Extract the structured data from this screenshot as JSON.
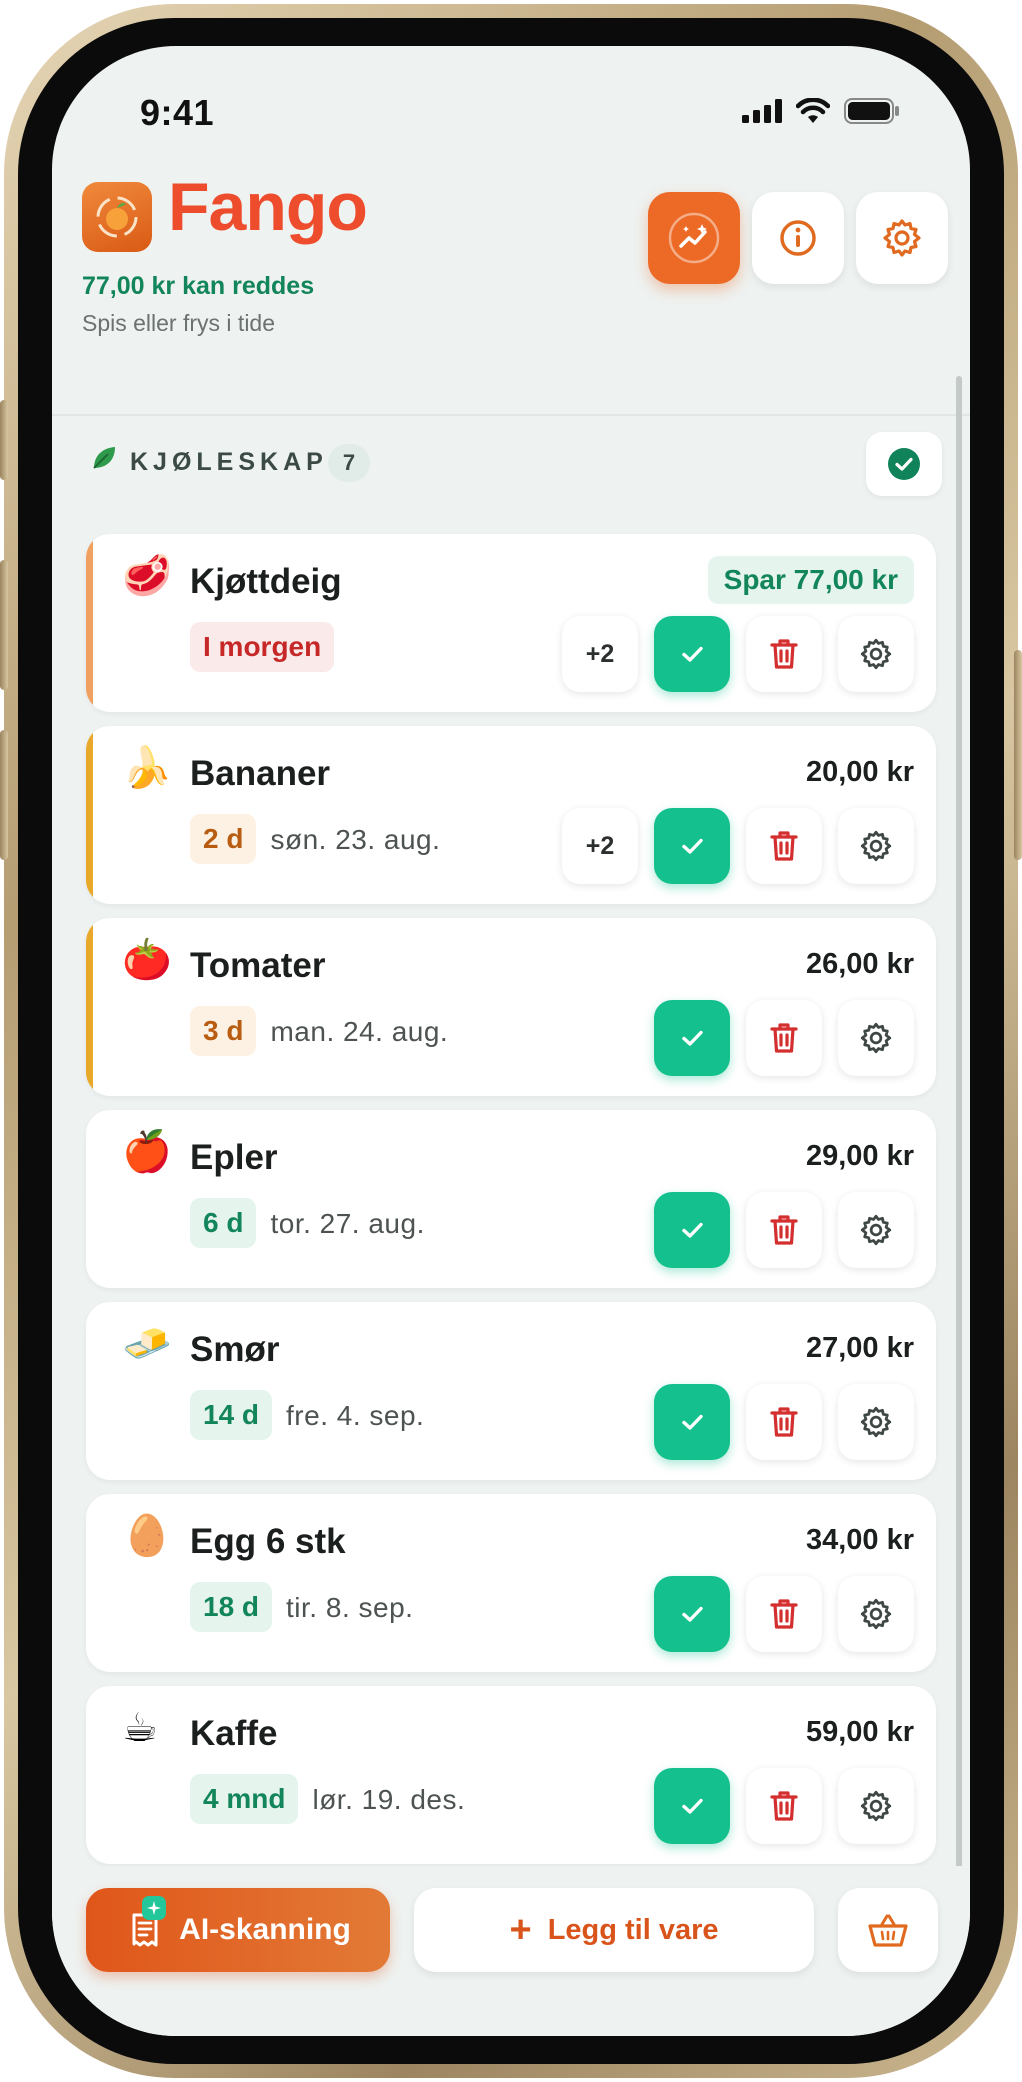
{
  "status_bar": {
    "time": "9:41"
  },
  "header": {
    "app_name": "Fango",
    "saved_amount": "77,00 kr kan reddes",
    "subtitle": "Spis eller frys i tide"
  },
  "section": {
    "title": "KJØLESKAP",
    "count": "7",
    "icon": "leaf-icon"
  },
  "items": [
    {
      "emoji": "🥩",
      "name": "Kjøttdeig",
      "price": "Spar 77,00 kr",
      "days": "I morgen",
      "date": "",
      "extra": "+2",
      "urgency": "red",
      "accent": "#f0a060"
    },
    {
      "emoji": "🍌",
      "name": "Bananer",
      "price": "20,00 kr",
      "days": "2 d",
      "date": "søn. 23. aug.",
      "extra": "+2",
      "urgency": "orange",
      "accent": "#e8a82a"
    },
    {
      "emoji": "🍅",
      "name": "Tomater",
      "price": "26,00 kr",
      "days": "3 d",
      "date": "man. 24. aug.",
      "extra": "",
      "urgency": "orange",
      "accent": "#e8a82a"
    },
    {
      "emoji": "🍎",
      "name": "Epler",
      "price": "29,00 kr",
      "days": "6 d",
      "date": "tor. 27. aug.",
      "extra": "",
      "urgency": "green",
      "accent": ""
    },
    {
      "emoji": "🧈",
      "name": "Smør",
      "price": "27,00 kr",
      "days": "14 d",
      "date": "fre. 4. sep.",
      "extra": "",
      "urgency": "green",
      "accent": ""
    },
    {
      "emoji": "🥚",
      "name": "Egg 6 stk",
      "price": "34,00 kr",
      "days": "18 d",
      "date": "tir. 8. sep.",
      "extra": "",
      "urgency": "green",
      "accent": ""
    },
    {
      "emoji": "☕",
      "name": "Kaffe",
      "price": "59,00 kr",
      "days": "4 mnd",
      "date": "lør. 19. des.",
      "extra": "",
      "urgency": "green",
      "accent": ""
    }
  ],
  "bottom": {
    "ai_scan_label": "AI-skanning",
    "add_item_label": "Legg til vare"
  },
  "colors": {
    "brand": "#ee4d2d",
    "accent_orange": "#ec6a26",
    "done_green": "#14c08e",
    "delete_red": "#d32f2f"
  }
}
